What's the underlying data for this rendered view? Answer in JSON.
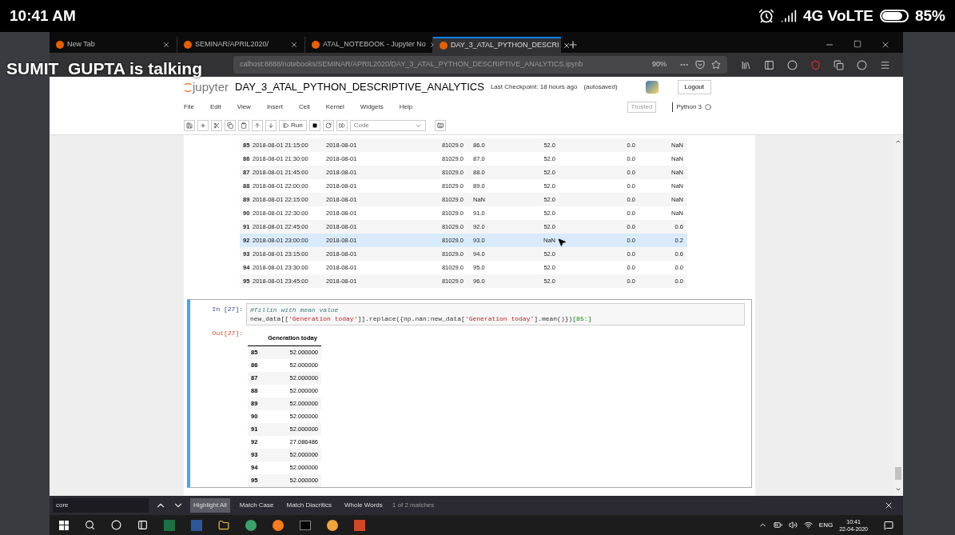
{
  "phone_status": {
    "time": "10:41 AM",
    "network": "4G VoLTE",
    "battery": "85%"
  },
  "speaker_overlay": "SUMIT  GUPTA is talking",
  "browser": {
    "tabs": [
      {
        "title": "New Tab",
        "selected": false
      },
      {
        "title": "SEMINAR/APRIL2020/",
        "selected": false
      },
      {
        "title": "ATAL_NOTEBOOK - Jupyter No",
        "selected": false
      },
      {
        "title": "DAY_3_ATAL_PYTHON_DESCRI",
        "selected": true
      }
    ],
    "url": "calhost:8888/notebooks/SEMINAR/APRIL2020/DAY_3_ATAL_PYTHON_DESCRIPTIVE_ANALYTICS.ipynb",
    "zoom": "90%"
  },
  "notebook": {
    "logo_text": "jupyter",
    "title": "DAY_3_ATAL_PYTHON_DESCRIPTIVE_ANALYTICS",
    "checkpoint": "Last Checkpoint: 18 hours ago",
    "autosave": "(autosaved)",
    "logout": "Logout",
    "menu": [
      "File",
      "Edit",
      "View",
      "Insert",
      "Cell",
      "Kernel",
      "Widgets",
      "Help"
    ],
    "trusted": "Trusted",
    "kernel": "Python 3",
    "run": "Run",
    "cell_type": "Code",
    "table_rows": [
      {
        "index": "85",
        "cells": [
          "2018-08-01 21:15:00",
          "2018-08-01",
          "81029.0",
          "86.0",
          "52.0",
          "0.0",
          "NaN"
        ],
        "highlighted": false
      },
      {
        "index": "86",
        "cells": [
          "2018-08-01 21:30:00",
          "2018-08-01",
          "81029.0",
          "87.0",
          "52.0",
          "0.0",
          "NaN"
        ],
        "highlighted": false
      },
      {
        "index": "87",
        "cells": [
          "2018-08-01 21:45:00",
          "2018-08-01",
          "81029.0",
          "88.0",
          "52.0",
          "0.0",
          "NaN"
        ],
        "highlighted": false
      },
      {
        "index": "88",
        "cells": [
          "2018-08-01 22:00:00",
          "2018-08-01",
          "81029.0",
          "89.0",
          "52.0",
          "0.0",
          "NaN"
        ],
        "highlighted": false
      },
      {
        "index": "89",
        "cells": [
          "2018-08-01 22:15:00",
          "2018-08-01",
          "81029.0",
          "NaN",
          "52.0",
          "0.0",
          "NaN"
        ],
        "highlighted": false
      },
      {
        "index": "90",
        "cells": [
          "2018-08-01 22:30:00",
          "2018-08-01",
          "81029.0",
          "91.0",
          "52.0",
          "0.0",
          "NaN"
        ],
        "highlighted": false
      },
      {
        "index": "91",
        "cells": [
          "2018-08-01 22:45:00",
          "2018-08-01",
          "81029.0",
          "92.0",
          "52.0",
          "0.0",
          "0.6"
        ],
        "highlighted": false
      },
      {
        "index": "92",
        "cells": [
          "2018-08-01 23:00:00",
          "2018-08-01",
          "81029.0",
          "93.0",
          "NaN",
          "0.0",
          "0.2"
        ],
        "highlighted": true
      },
      {
        "index": "93",
        "cells": [
          "2018-08-01 23:15:00",
          "2018-08-01",
          "81029.0",
          "94.0",
          "52.0",
          "0.0",
          "0.6"
        ],
        "highlighted": false
      },
      {
        "index": "94",
        "cells": [
          "2018-08-01 23:30:00",
          "2018-08-01",
          "81029.0",
          "95.0",
          "52.0",
          "0.0",
          "0.0"
        ],
        "highlighted": false
      },
      {
        "index": "95",
        "cells": [
          "2018-08-01 23:45:00",
          "2018-08-01",
          "81029.0",
          "96.0",
          "52.0",
          "0.0",
          "0.0"
        ],
        "highlighted": false
      }
    ],
    "code_cell": {
      "prompt": "In [27]:",
      "comment": "#fillin with mean value",
      "code": [
        {
          "kind": "plain",
          "text": "new_data[["
        },
        {
          "kind": "string",
          "text": "'Generation today'"
        },
        {
          "kind": "plain",
          "text": "]].replace({np.nan:new_data["
        },
        {
          "kind": "string",
          "text": "'Generation today'"
        },
        {
          "kind": "plain",
          "text": "].mean()})"
        },
        {
          "kind": "number",
          "text": "[85:]"
        }
      ]
    },
    "out_prompt": "Out[27]:",
    "output_table": {
      "column": "Generation today",
      "rows": [
        {
          "index": "85",
          "value": "52.000000"
        },
        {
          "index": "86",
          "value": "52.000000"
        },
        {
          "index": "87",
          "value": "52.000000"
        },
        {
          "index": "88",
          "value": "52.000000"
        },
        {
          "index": "89",
          "value": "52.000000"
        },
        {
          "index": "90",
          "value": "52.000000"
        },
        {
          "index": "91",
          "value": "52.000000"
        },
        {
          "index": "92",
          "value": "27.086486"
        },
        {
          "index": "93",
          "value": "52.000000"
        },
        {
          "index": "94",
          "value": "52.000000"
        },
        {
          "index": "95",
          "value": "52.000000"
        }
      ]
    }
  },
  "find_bar": {
    "query": "core",
    "options": [
      {
        "label": "Highlight All",
        "selected": true
      },
      {
        "label": "Match Case",
        "selected": false
      },
      {
        "label": "Match Diacritics",
        "selected": false
      },
      {
        "label": "Whole Words",
        "selected": false
      }
    ],
    "status": "1 of 2 matches"
  },
  "taskbar": {
    "language": "ENG",
    "time": "10:41",
    "date": "22-04-2020"
  }
}
